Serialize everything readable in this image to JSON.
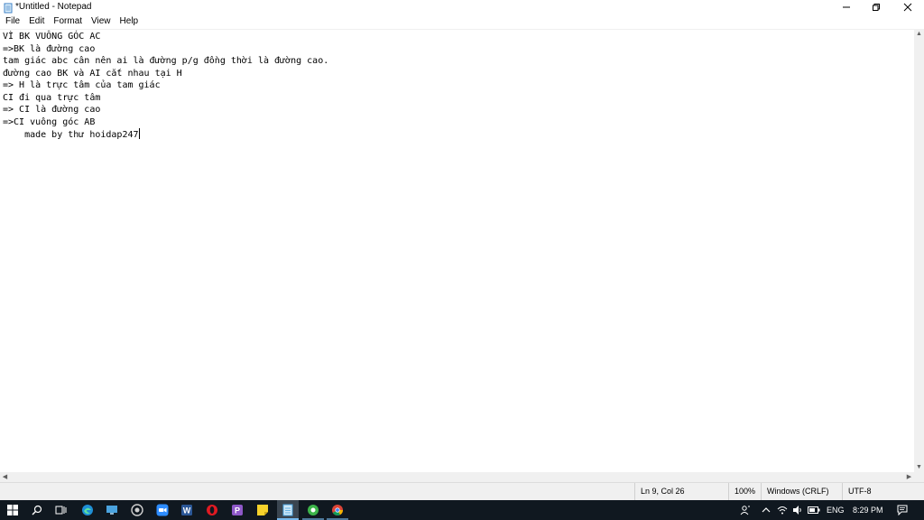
{
  "window": {
    "title": "*Untitled - Notepad"
  },
  "menu": [
    "File",
    "Edit",
    "Format",
    "View",
    "Help"
  ],
  "editor": {
    "lines": [
      "VÌ BK VUÔNG GÓC AC",
      "=>BK là đường cao",
      "tam giác abc cân nên ai là đường p/g đồng thời là đường cao.",
      "đường cao BK và AI cắt nhau tại H",
      "=> H là trực tâm của tam giác",
      "CI đi qua trực tâm",
      "=> CI là đường cao",
      "=>CI vuông góc AB",
      "    made by thư hoidap247"
    ]
  },
  "status": {
    "position": "Ln 9, Col 26",
    "zoom": "100%",
    "line_ending": "Windows (CRLF)",
    "encoding": "UTF-8"
  },
  "taskbar": {
    "language": "ENG",
    "time": "8:29 PM"
  },
  "colors": {
    "taskbar": "#101820",
    "accent": "#76b9ed",
    "statusbar": "#f0f0f0"
  }
}
